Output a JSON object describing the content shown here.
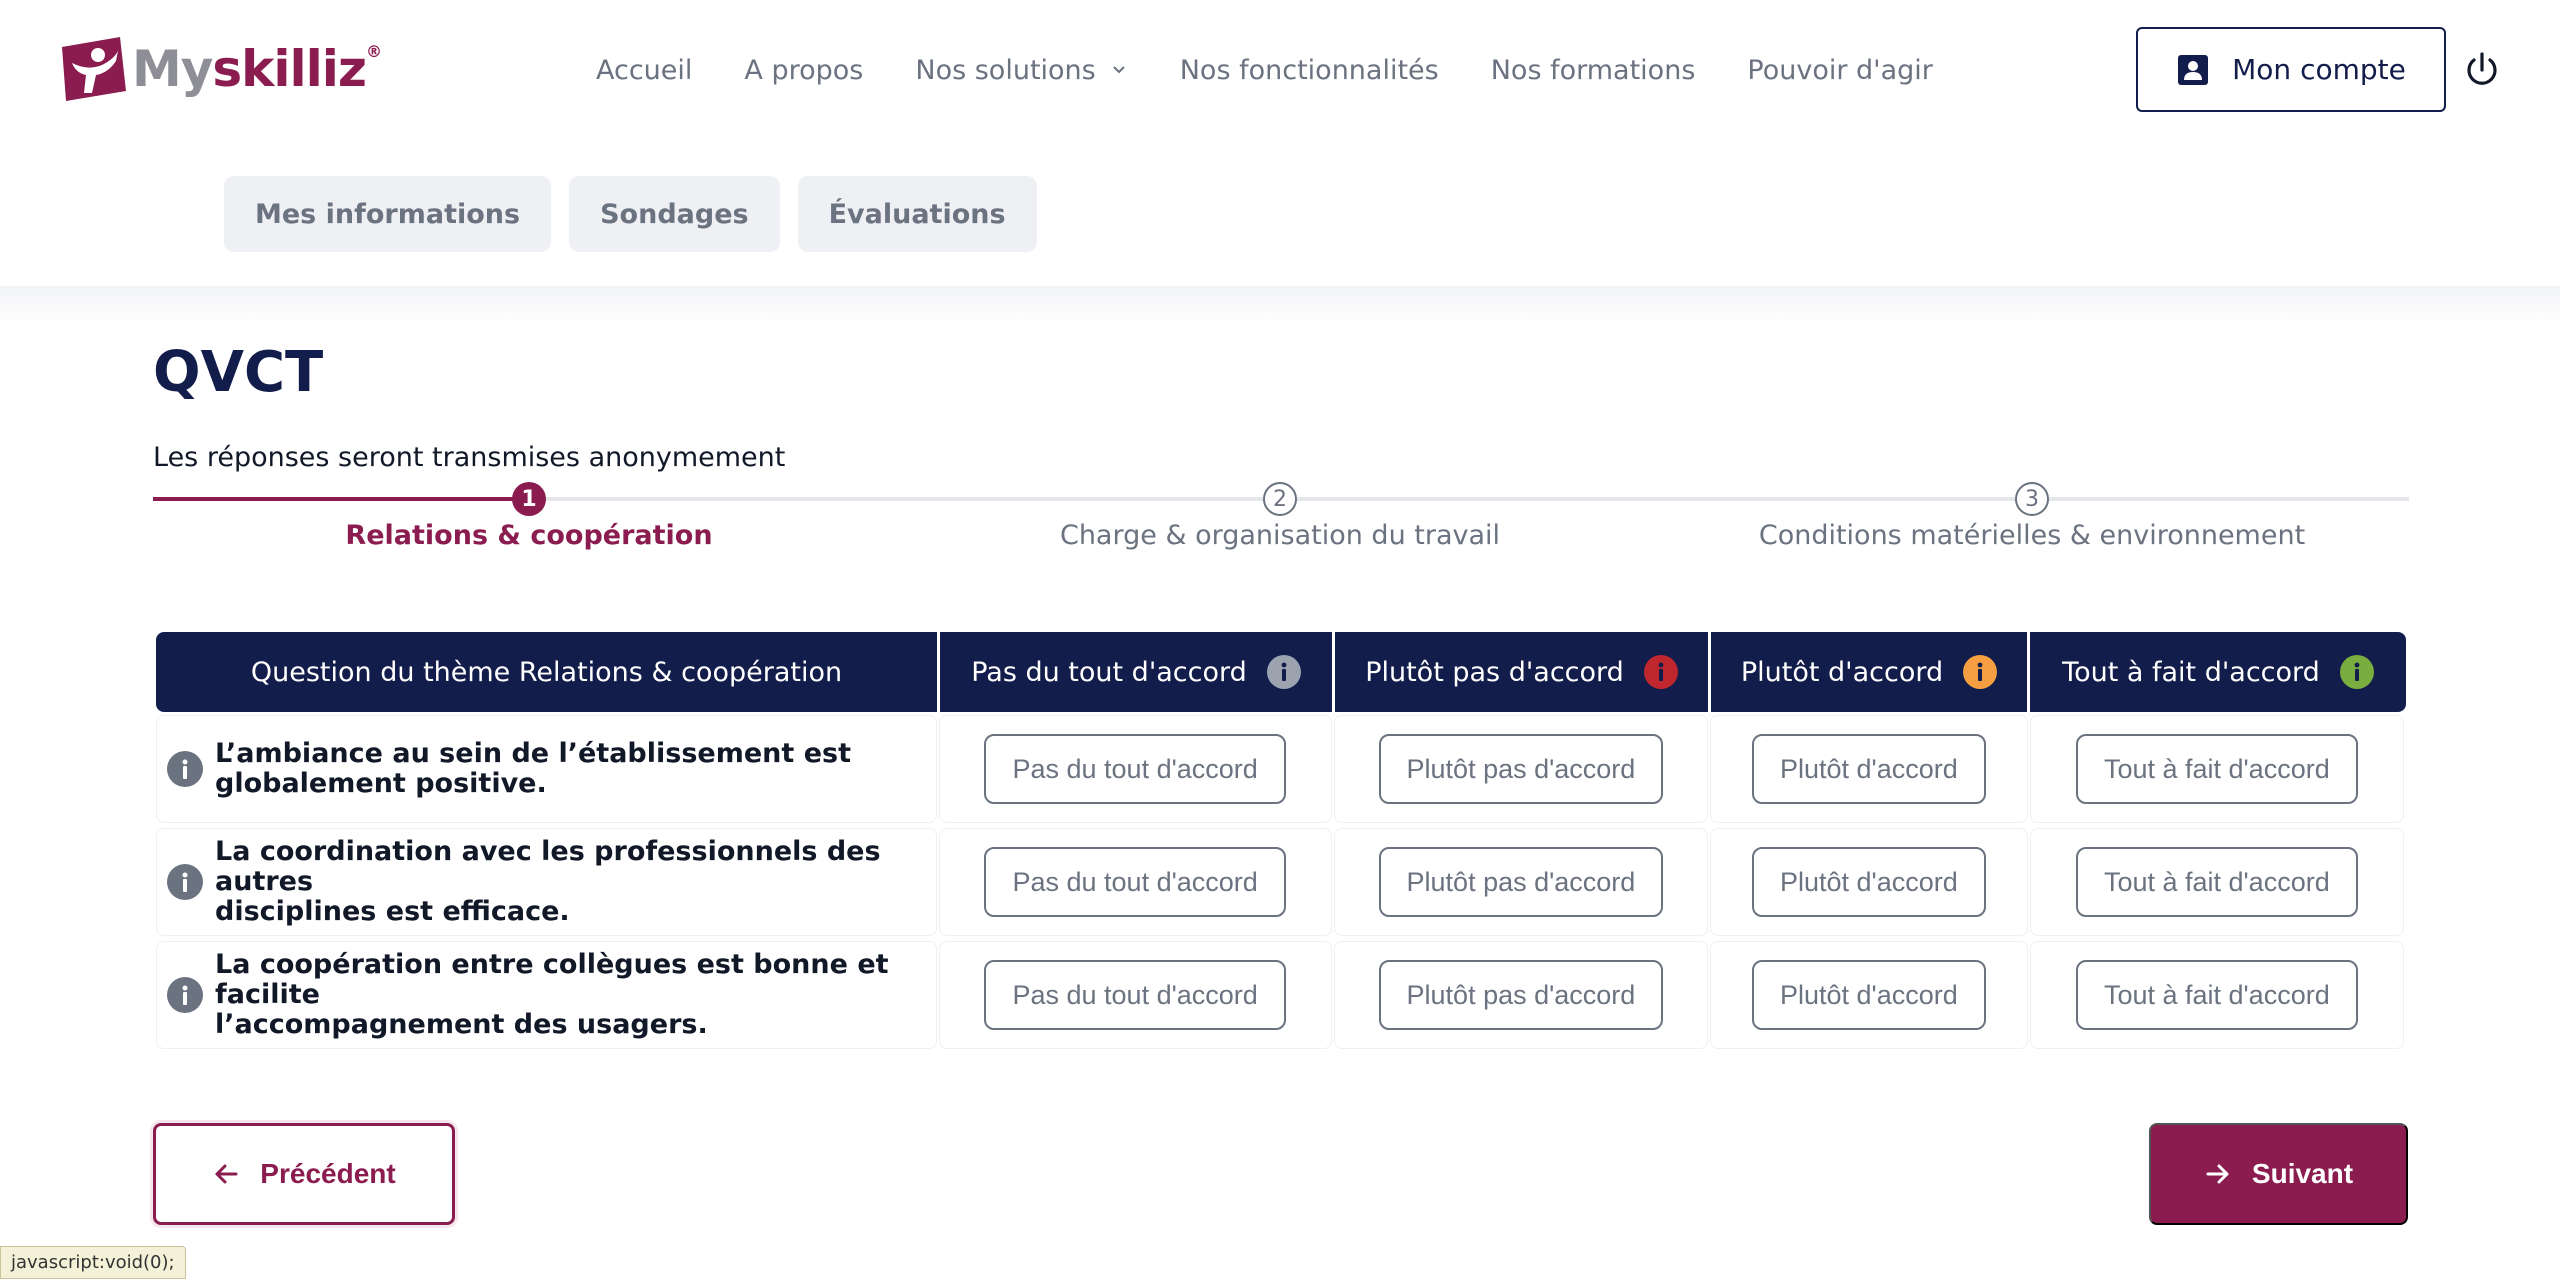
{
  "brand": {
    "name_part1": "My",
    "name_part2": "skilliz",
    "registered": "®",
    "primary_color": "#8b1c4f",
    "navy_color": "#131d4b"
  },
  "nav": {
    "items": [
      {
        "label": "Accueil"
      },
      {
        "label": "A propos"
      },
      {
        "label": "Nos solutions",
        "has_dropdown": true
      },
      {
        "label": "Nos fonctionnalités"
      },
      {
        "label": "Nos formations"
      },
      {
        "label": "Pouvoir d'agir"
      }
    ],
    "account_label": "Mon compte",
    "account_icon": "account-box-icon",
    "power_icon": "power-icon"
  },
  "subtabs": [
    {
      "label": "Mes informations"
    },
    {
      "label": "Sondages"
    },
    {
      "label": "Évaluations"
    }
  ],
  "page": {
    "title": "QVCT",
    "subtitle": "Les réponses seront transmises anonymement"
  },
  "stepper": {
    "current": 1,
    "steps": [
      {
        "number": "1",
        "label": "Relations & coopération"
      },
      {
        "number": "2",
        "label": "Charge & organisation du travail"
      },
      {
        "number": "3",
        "label": "Conditions matérielles & environnement"
      }
    ]
  },
  "table": {
    "headers": {
      "question": "Question du thème Relations & coopération",
      "a": "Pas du tout d'accord",
      "b": "Plutôt pas d'accord",
      "c": "Plutôt d'accord",
      "d": "Tout à fait d'accord"
    },
    "header_info_colors": {
      "a": "#9ca3af",
      "b": "#c0262d",
      "c": "#f59e42",
      "d": "#7aad3f"
    },
    "rows": [
      {
        "question": "L’ambiance au sein de l’établissement est globalement positive.",
        "line1": "L’ambiance au sein de l’établissement est",
        "line2": "globalement positive."
      },
      {
        "question": "La coordination avec les professionnels des autres disciplines est efficace.",
        "line1": "La coordination avec les professionnels des autres",
        "line2": "disciplines est efficace."
      },
      {
        "question": "La coopération entre collègues est bonne et facilite l’accompagnement des usagers.",
        "line1": "La coopération entre collègues est bonne et facilite",
        "line2": "l’accompagnement des usagers."
      }
    ],
    "answer_labels": {
      "a": "Pas du tout d'accord",
      "b": "Plutôt pas d'accord",
      "c": "Plutôt d'accord",
      "d": "Tout à fait d'accord"
    }
  },
  "footer": {
    "prev_label": "Précédent",
    "next_label": "Suivant"
  },
  "status_bar": "javascript:void(0);"
}
